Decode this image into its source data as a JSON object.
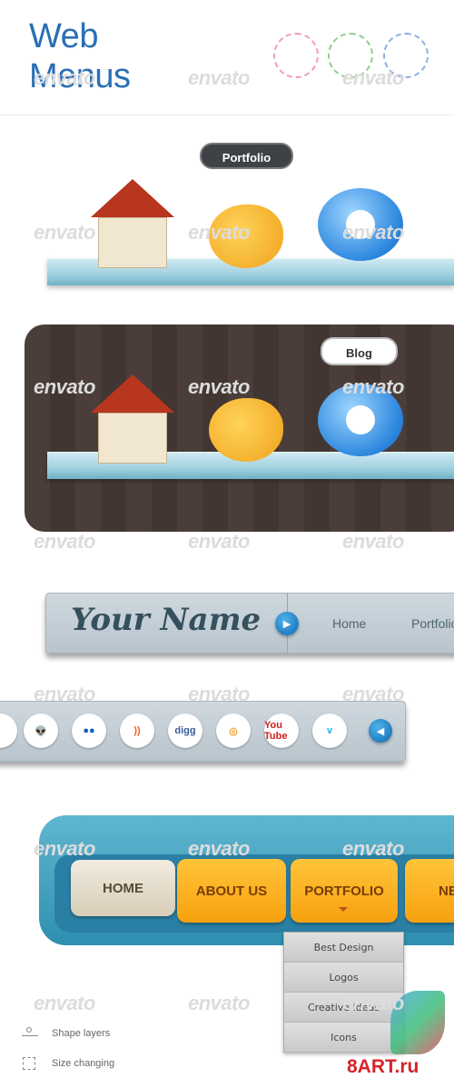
{
  "header": {
    "title_line1": "Web",
    "title_line2": "Menus",
    "style_swatches": [
      "#f0a0b0",
      "#8fd08f",
      "#8fb0e0"
    ]
  },
  "watermark": "envato",
  "shelf_light": {
    "tooltip": "Portfolio",
    "icons": [
      "home-icon",
      "palette-icon",
      "chat-bubble-icon"
    ]
  },
  "shelf_dark": {
    "tooltip": "Blog",
    "icons": [
      "home-icon",
      "palette-icon",
      "chat-bubble-icon"
    ]
  },
  "metal_nav": {
    "brand": "Your Name",
    "items": [
      "Home",
      "Portfolio"
    ]
  },
  "social_bar": {
    "icons": [
      {
        "name": "reddit-icon",
        "glyph": "👽"
      },
      {
        "name": "flickr-icon",
        "glyph": "●●"
      },
      {
        "name": "rss-icon",
        "glyph": "))"
      },
      {
        "name": "digg-icon",
        "glyph": "digg"
      },
      {
        "name": "lifebuoy-icon",
        "glyph": "◎"
      },
      {
        "name": "youtube-icon",
        "glyph": "You Tube"
      },
      {
        "name": "vimeo-icon",
        "glyph": "v"
      }
    ]
  },
  "orange_nav": {
    "items": [
      "HOME",
      "ABOUT US",
      "PORTFOLIO",
      "NE"
    ],
    "active": "HOME",
    "dropdown": [
      "Best Design",
      "Logos",
      "Creative Ideas",
      "Icons"
    ]
  },
  "legend": {
    "items": [
      "Shape layers",
      "Size changing"
    ]
  },
  "site_logo": "8ART.ru",
  "colors": {
    "title": "#2a6fb5",
    "orange": "#f7a10e",
    "frame": "#2f8fb1"
  }
}
